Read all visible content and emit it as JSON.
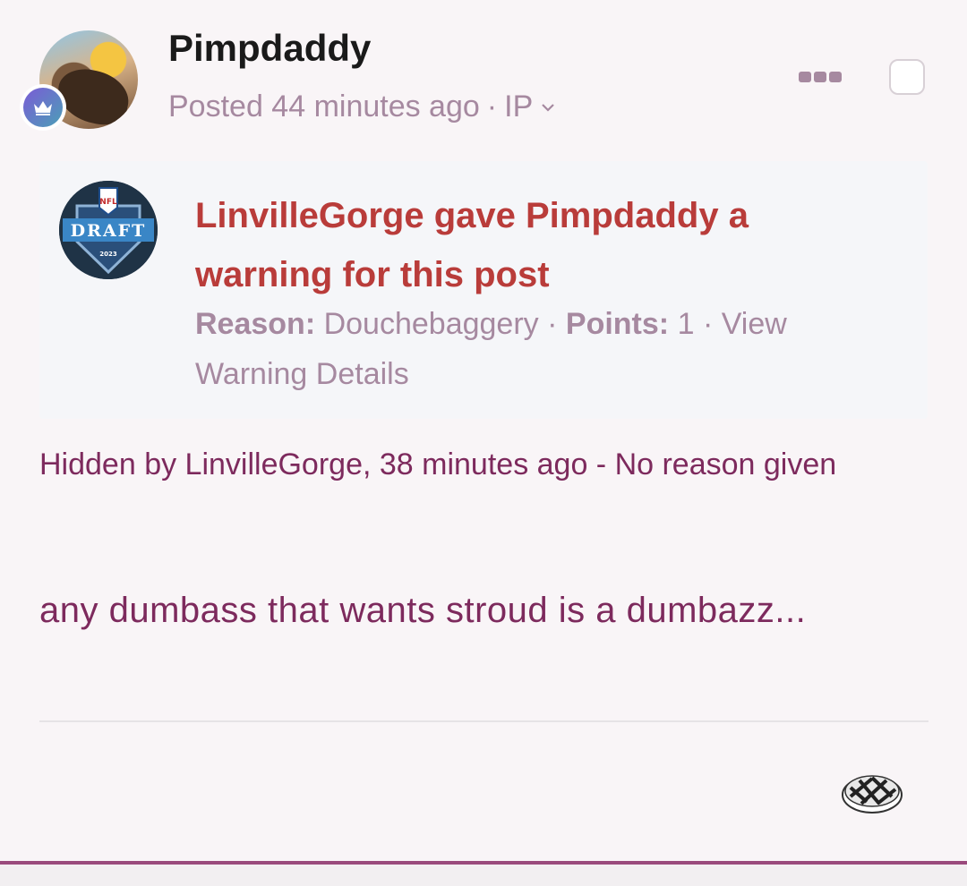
{
  "post": {
    "username": "Pimpdaddy",
    "posted_text": "Posted 44 minutes ago",
    "separator": "·",
    "ip_label": "IP"
  },
  "warning": {
    "title": "LinvilleGorge gave Pimpdaddy a warning for this post",
    "reason_label": "Reason:",
    "reason_value": "Douchebaggery",
    "points_label": "Points:",
    "points_value": "1",
    "separator": "·",
    "link_text": "View Warning Details",
    "avatar_text": "DRAFT",
    "avatar_logo_text": "NFL",
    "avatar_year": "2023"
  },
  "hidden_note": "Hidden by LinvilleGorge, 38 minutes ago - No reason given",
  "content": "any dumbass that wants stroud is a dumbazz...",
  "colors": {
    "warning_title": "#b93c3a",
    "meta": "#a689a0",
    "content": "#7d2a5d",
    "accent_border": "#9a4a7c"
  },
  "icons": {
    "more": "ellipsis-icon",
    "badge": "crown-icon",
    "reaction": "pie-reaction-icon",
    "ip_dropdown": "chevron-down-icon"
  }
}
